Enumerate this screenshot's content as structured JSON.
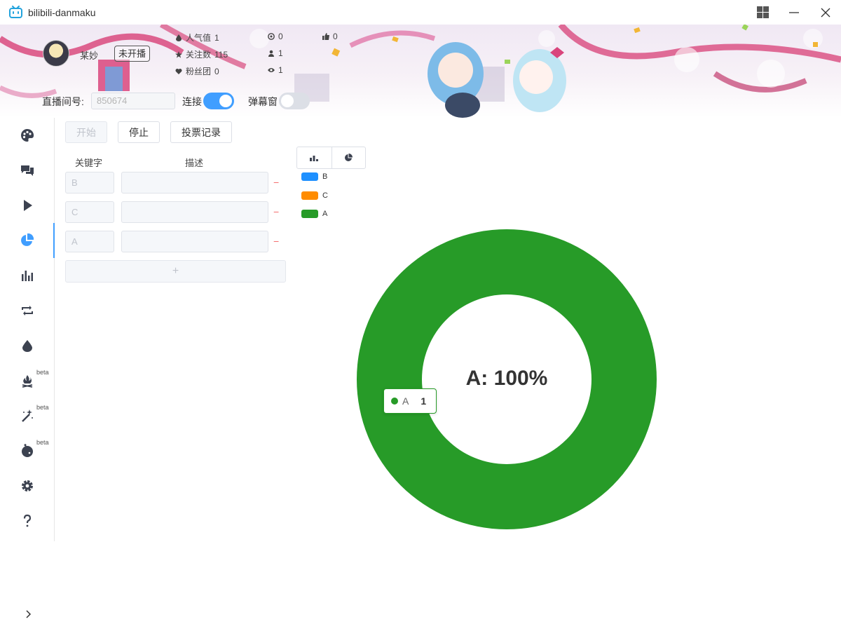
{
  "window": {
    "title": "bilibili-danmaku"
  },
  "user": {
    "name": "某妙",
    "live_status": "未开播",
    "stats": {
      "popularity_label": "人气值",
      "popularity": "1",
      "follow_label": "关注数",
      "follow": "115",
      "fans_club_label": "粉丝团",
      "fans_club": "0",
      "gift_count": "0",
      "member_count": "1",
      "viewers": "1",
      "likes": "0"
    }
  },
  "room": {
    "label": "直播间号:",
    "value": "850674",
    "connect_label": "连接",
    "connect_on": true,
    "popup_label": "弹幕窗",
    "popup_on": false
  },
  "sidebar": {
    "items": [
      {
        "icon": "palette-icon"
      },
      {
        "icon": "chat-icon"
      },
      {
        "icon": "play-icon"
      },
      {
        "icon": "pie-chart-icon",
        "active": true
      },
      {
        "icon": "bar-chart-icon"
      },
      {
        "icon": "repeat-icon"
      },
      {
        "icon": "drop-icon"
      },
      {
        "icon": "campfire-icon",
        "badge": "beta"
      },
      {
        "icon": "magic-wand-icon",
        "badge": "beta"
      },
      {
        "icon": "robot-icon",
        "badge": "beta"
      },
      {
        "icon": "gear-icon"
      },
      {
        "icon": "help-icon"
      }
    ],
    "collapse_icon": "chevron-right-icon"
  },
  "toolbar": {
    "start": "开始",
    "stop": "停止",
    "vote_log": "投票记录"
  },
  "vote": {
    "keyword_header": "关键字",
    "desc_header": "描述",
    "rows": [
      {
        "keyword": "B",
        "desc": ""
      },
      {
        "keyword": "C",
        "desc": ""
      },
      {
        "keyword": "A",
        "desc": ""
      }
    ],
    "remove_symbol": "−",
    "add_symbol": "+"
  },
  "chart_toggle": {
    "options": [
      "bar-chart-icon",
      "pie-chart-icon"
    ],
    "selected": "pie-chart-icon"
  },
  "tooltip": {
    "name": "A",
    "value": "1"
  },
  "colors": {
    "B": "#1e90ff",
    "C": "#ff8c00",
    "A": "#279b28",
    "accent": "#409eff"
  },
  "chart_data": {
    "type": "pie",
    "donut": true,
    "categories": [
      "B",
      "C",
      "A"
    ],
    "values": [
      0,
      0,
      1
    ],
    "legend": [
      "B",
      "C",
      "A"
    ],
    "legend_position": "top-left",
    "center_label": "A: 100%"
  }
}
